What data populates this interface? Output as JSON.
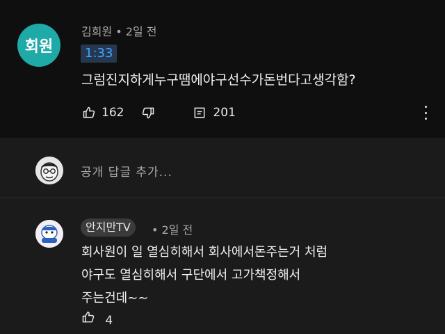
{
  "top_comment": {
    "avatar_text": "회원",
    "author": "김희원",
    "time": "2일 전",
    "timestamp_link": "1:33",
    "text": "그럼진지하게누구땜에야구선수가돈번다고생각함?",
    "likes": "162",
    "replies": "201"
  },
  "reply_box": {
    "placeholder": "공개 답글 추가..."
  },
  "second_comment": {
    "author": "안지만TV",
    "time": "2일 전",
    "lines": [
      "회사원이 일 열심히해서 회사에서돈주는거 처럼",
      "야구도 열심히해서 구단에서 고가책정해서",
      "주는건데~~"
    ],
    "likes_partial": "4"
  }
}
